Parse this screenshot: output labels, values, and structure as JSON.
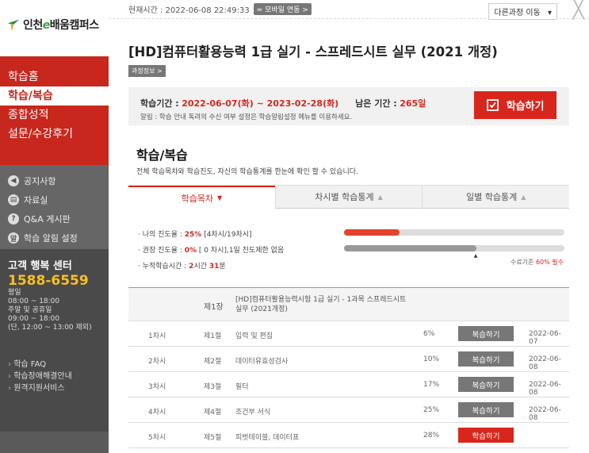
{
  "sidebar": {
    "logo_prefix": "인천",
    "logo_e": "e",
    "logo_suffix": "배움캠퍼스",
    "nav": [
      "학습홈",
      "학습/복습",
      "종합성적",
      "설문/수강후기"
    ],
    "menu": [
      {
        "icon": "speaker-icon",
        "glyph": "◀",
        "label": "공지사항"
      },
      {
        "icon": "folder-icon",
        "glyph": "▤",
        "label": "자료실"
      },
      {
        "icon": "question-icon",
        "glyph": "?",
        "label": "Q&A 게시판"
      },
      {
        "icon": "bell-icon",
        "glyph": "알",
        "label": "학습 알림 설정"
      }
    ],
    "support": {
      "title": "고객 행복 센터",
      "phone": "1588-6559",
      "lines": [
        "평일",
        "08:00 ~ 18:00",
        "주말 및 공휴일",
        "09:00 ~ 18:00",
        "(단, 12:00 ~ 13:00 제외)"
      ]
    },
    "links": [
      "학습 FAQ",
      "학습장애해결안내",
      "원격지원서비스"
    ]
  },
  "topbar": {
    "time_label": "현재시간 : 2022-06-08 22:49:33",
    "mobile": "모바일 연동 >",
    "other_course": "다른과정 이동",
    "caret": "▾",
    "close": "╳"
  },
  "course": {
    "title": "[HD]컴퓨터활용능력 1급 실기 - 스프레드시트 실무 (2021 개정)",
    "info_badge": "과정정보 >"
  },
  "period": {
    "label": "학습기간 :",
    "range": "2022-06-07(화) ~ 2023-02-28(화)",
    "remain_label": "남은 기간 :",
    "remain_value": "265일",
    "note": "알림 : 학습 안내 독려의 수신 여부 설정은 학습알림설정 메뉴를 이용하세요.",
    "button": "학습하기"
  },
  "section": {
    "title": "학습/복습",
    "desc": "전체 학습목차와 학습진도, 자신의 학습통계를 한눈에 확인 할 수 있습니다."
  },
  "tabs": [
    {
      "label": "학습목차",
      "arrow": "▼"
    },
    {
      "label": "차시별 학습통계",
      "arrow": "▲"
    },
    {
      "label": "일별 학습통계",
      "arrow": "▲"
    }
  ],
  "stats": {
    "my_label": "· 나의 진도율 :",
    "my_value": "25%",
    "my_detail": "[4차시/19차시]",
    "my_progress": 0.25,
    "rec_label": "· 권장 진도율 :",
    "rec_value": "0%",
    "rec_detail": "[ 0 차시],1일 진도제한 없음",
    "rec_progress": 0.6,
    "time_label": "· 누적학습시간 :",
    "time_h": "2",
    "time_h_unit": "시간",
    "time_m": "31",
    "time_m_unit": "분",
    "threshold_prefix": "수료기준",
    "threshold_value": "60% 필수",
    "marker": "▲"
  },
  "table": {
    "chapter_no": "제1장",
    "chapter_name": "[HD]컴퓨터활용능력시험 1급 실기 - 1과목 스프레드시트 실무 (2021개정)",
    "rows": [
      {
        "session": "1차시",
        "section": "제1절",
        "title": "입력 및 편집",
        "pct": "6%",
        "button": "복습하기",
        "date": "2022-06-07"
      },
      {
        "session": "2차시",
        "section": "제2절",
        "title": "데이터유효성검사",
        "pct": "10%",
        "button": "복습하기",
        "date": "2022-06-08"
      },
      {
        "session": "3차시",
        "section": "제3절",
        "title": "필터",
        "pct": "17%",
        "button": "복습하기",
        "date": "2022-06-08"
      },
      {
        "session": "4차시",
        "section": "제4절",
        "title": "조건부 서식",
        "pct": "25%",
        "button": "복습하기",
        "date": "2022-06-08"
      },
      {
        "session": "5차시",
        "section": "제5절",
        "title": "피벗테이블, 데이터표",
        "pct": "28%",
        "button": "학습하기",
        "date": ""
      }
    ]
  },
  "colors": {
    "accent_red": "#d9261c",
    "sidebar_red": "#c8271d",
    "review_grey": "#777777",
    "phone_yellow": "#f7c022"
  }
}
